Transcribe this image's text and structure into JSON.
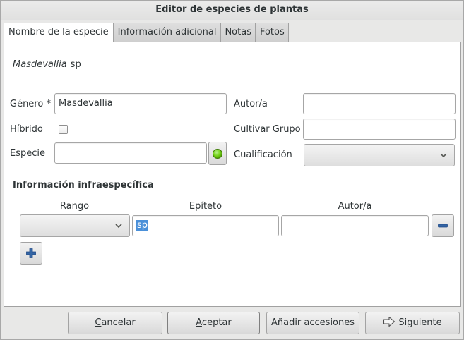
{
  "window": {
    "title": "Editor de especies de plantas"
  },
  "tabs": [
    {
      "label": "Nombre de la especie",
      "active": true
    },
    {
      "label": "Información adicional",
      "active": false
    },
    {
      "label": "Notas",
      "active": false
    },
    {
      "label": "Fotos",
      "active": false
    }
  ],
  "species_display": {
    "genus": "Masdevallia",
    "epithet": "sp"
  },
  "form": {
    "genus_label": "Género",
    "genus_required_marker": "*",
    "genus_value": "Masdevallia",
    "hybrid_label": "Híbrido",
    "hybrid_checked": false,
    "species_label": "Especie",
    "species_value": "",
    "species_status_color": "#4e9a06",
    "author_label": "Autor/a",
    "author_value": "",
    "cultivar_group_label": "Cultivar Grupo",
    "cultivar_group_value": "",
    "qualification_label": "Cualificación",
    "qualification_value": ""
  },
  "infraspecific": {
    "title": "Información infraespecífica",
    "columns": {
      "rank": "Rango",
      "epithet": "Epíteto",
      "author": "Autor/a"
    },
    "rows": [
      {
        "rank": "",
        "epithet": "sp",
        "epithet_selected": true,
        "author": ""
      }
    ]
  },
  "buttons": {
    "cancel": {
      "mnemonic": "C",
      "rest": "ancelar"
    },
    "accept": {
      "mnemonic": "A",
      "rest": "ceptar"
    },
    "add_accessions": "Añadir accesiones",
    "next": "Siguiente"
  },
  "colors": {
    "selection": "#4a90d9",
    "panel_bg": "#ffffff",
    "window_bg": "#e8e8e7"
  }
}
